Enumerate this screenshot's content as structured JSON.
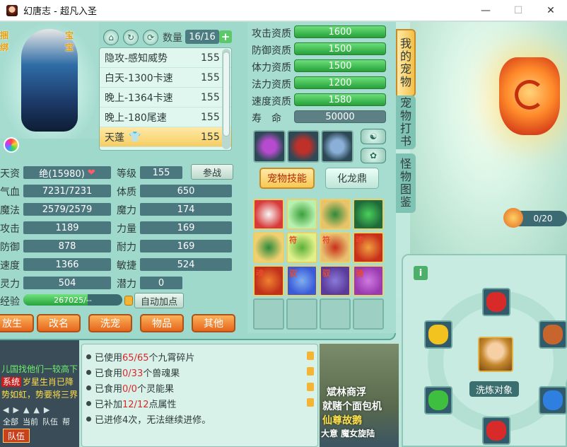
{
  "window": {
    "title": "幻唐志 - 超凡入圣",
    "minimize": "—",
    "maximize": "☐",
    "close": "✕"
  },
  "pet_badges": {
    "left": "捆绑",
    "right": "宝宝"
  },
  "quantity": {
    "label": "数量",
    "value": "16/16",
    "add": "+"
  },
  "pet_list": [
    {
      "name": "隐攻-感知威势",
      "level": "155"
    },
    {
      "name": "白天-1300卡速",
      "level": "155"
    },
    {
      "name": "晚上-1364卡速",
      "level": "155"
    },
    {
      "name": "晚上-180尾速",
      "level": "155"
    },
    {
      "name": "天蓬",
      "level": "155",
      "selected": true
    }
  ],
  "stats": {
    "aptitude_label": "天资",
    "aptitude_value": "绝(15980)",
    "level_label": "等级",
    "level_value": "155",
    "join_battle": "参战",
    "hp_label": "气血",
    "hp_value": "7231/7231",
    "con_label": "体质",
    "con_value": "650",
    "mp_label": "魔法",
    "mp_value": "2579/2579",
    "mag_label": "魔力",
    "mag_value": "174",
    "atk_label": "攻击",
    "atk_value": "1189",
    "str_label": "力量",
    "str_value": "169",
    "def_label": "防御",
    "def_value": "878",
    "end_label": "耐力",
    "end_value": "169",
    "spd_label": "速度",
    "spd_value": "1366",
    "agi_label": "敏捷",
    "agi_value": "524",
    "spirit_label": "灵力",
    "spirit_value": "504",
    "pot_label": "潜力",
    "pot_value": "0",
    "exp_label": "经验",
    "exp_value": "267025/--",
    "exp_fill": 0.65,
    "auto_points": "自动加点"
  },
  "actions": [
    "放生",
    "改名",
    "洗宠",
    "物品",
    "其他"
  ],
  "aptitudes": [
    {
      "label": "攻击资质",
      "value": "1600"
    },
    {
      "label": "防御资质",
      "value": "1500"
    },
    {
      "label": "体力资质",
      "value": "1500"
    },
    {
      "label": "法力资质",
      "value": "1200"
    },
    {
      "label": "速度资质",
      "value": "1580"
    },
    {
      "label": "寿　命",
      "value": "50000"
    }
  ],
  "skill_tabs": {
    "active": "宠物技能",
    "other": "化龙鼎"
  },
  "skill_tags": [
    "",
    "",
    "",
    "",
    "",
    "符",
    "符",
    "魂",
    "魂",
    "驭",
    "驭",
    "骑"
  ],
  "side_tabs": [
    "我的宠物",
    "宠物打书",
    "怪物图鉴"
  ],
  "pet_counter": "0/20",
  "info_lines": [
    {
      "text": "已使用",
      "num": "65/65",
      "rest": "个九霄碎片"
    },
    {
      "text": "已食用",
      "num": "0/33",
      "rest": "个兽魂果"
    },
    {
      "text": "已食用",
      "num": "0/0",
      "rest": "个灵能果"
    },
    {
      "text": "已补加",
      "num": "12/12",
      "rest": "点属性"
    },
    {
      "text": "已进修4次，无法继续进修。",
      "num": "",
      "rest": ""
    }
  ],
  "chat": {
    "line1": "儿国找他们一较高下",
    "system_tag": "系统",
    "line2": "岁星生肖已降",
    "line3": "势如虹，势要将三界",
    "tabs": [
      "全部",
      "当前",
      "队伍",
      "帮"
    ],
    "team_btn": "队伍"
  },
  "scene_signs": [
    "斌林商浮",
    "就赌个面包机",
    "仙尊故鹅",
    "大意 魔女旋陆"
  ],
  "wash": {
    "label": "洗炼对象",
    "info": "i"
  },
  "colors": {
    "accent_green": "#27a03a",
    "orange": "#e7651c",
    "panel": "#9fd9cb"
  }
}
